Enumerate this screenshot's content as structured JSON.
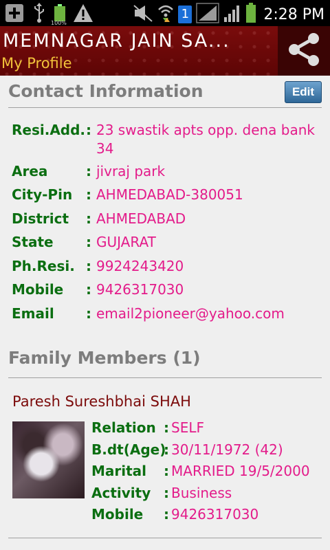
{
  "status_bar": {
    "time": "2:28 PM",
    "battery_small_label": "100%",
    "sim_badge": "1",
    "icons": [
      "add-icon",
      "usb-icon",
      "battery-icon",
      "warning-icon",
      "mute-icon",
      "wifi-icon",
      "sim-icon",
      "signal-icon",
      "signal-icon",
      "battery-icon"
    ]
  },
  "app_bar": {
    "title": "MEMNAGAR JAIN SA...",
    "subtitle": "My Profile",
    "share_icon": "share-icon"
  },
  "contact": {
    "heading": "Contact Information",
    "edit_label": "Edit",
    "fields": [
      {
        "label": "Resi.Add.",
        "value": "23 swastik apts opp. dena bank",
        "value2": "34"
      },
      {
        "label": "Area",
        "value": "jivraj park"
      },
      {
        "label": "City-Pin",
        "value": "AHMEDABAD-380051"
      },
      {
        "label": "District",
        "value": "AHMEDABAD"
      },
      {
        "label": "State",
        "value": "GUJARAT"
      },
      {
        "label": "Ph.Resi.",
        "value": "9924243420"
      },
      {
        "label": "Mobile",
        "value": "9426317030"
      },
      {
        "label": "Email",
        "value": "email2pioneer@yahoo.com"
      }
    ]
  },
  "family": {
    "heading": "Family Members (1)",
    "members": [
      {
        "name": "Paresh Sureshbhai SHAH",
        "fields": [
          {
            "label": "Relation",
            "value": "SELF"
          },
          {
            "label": "B.dt(Age)",
            "value": "30/11/1972 (42)"
          },
          {
            "label": "Marital",
            "value": "MARRIED 19/5/2000"
          },
          {
            "label": "Activity",
            "value": "Business"
          },
          {
            "label": "Mobile",
            "value": "9426317030"
          }
        ]
      }
    ]
  },
  "colors": {
    "label_green": "#0b6e11",
    "value_pink": "#e31b8a",
    "header_maroon": "#6d0808",
    "subtitle_gold": "#f2c23a",
    "name_maroon": "#7b0a0a"
  }
}
